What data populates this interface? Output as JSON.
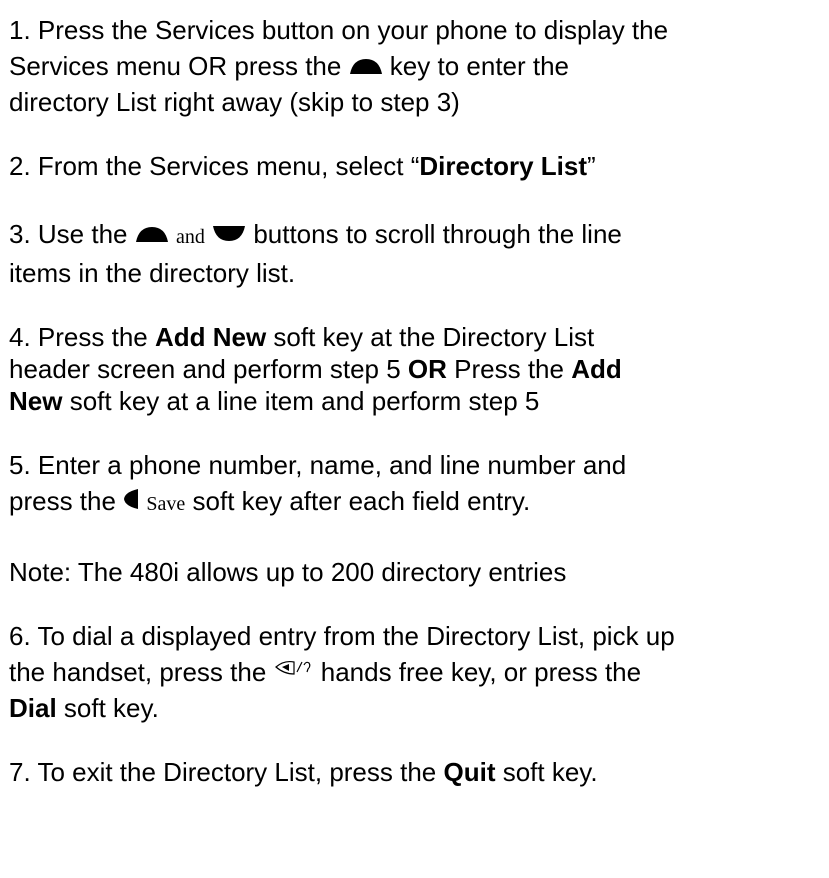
{
  "step1": {
    "l1": "1. Press the Services button on your phone to display the",
    "l2a": "Services menu OR press the ",
    "l2b": " key to enter the",
    "l3": "directory List right away (skip to step 3)"
  },
  "step2": {
    "a": "2. From the Services menu, select “",
    "bold": "Directory List",
    "b": "”"
  },
  "step3": {
    "a": "3. Use the ",
    "and": "and",
    "b": " buttons to scroll through the line",
    "l2": "items in the directory list."
  },
  "step4": {
    "l1a": "4. Press the ",
    "l1bold": "Add New",
    "l1b": " soft key at the Directory List",
    "l2a": "header screen and perform step 5 ",
    "l2bold1": "OR",
    "l2b": " Press the ",
    "l2bold2": "Add",
    "l3bold": "New",
    "l3b": " soft key at a line item and perform step 5"
  },
  "step5": {
    "l1": "5. Enter a phone number, name, and line number and",
    "l2a": "press the ",
    "save": "Save",
    "l2b": " soft key after each field entry."
  },
  "note": "Note: The 480i allows up to 200 directory entries",
  "step6": {
    "l1": "6. To dial a displayed entry from the Directory List, pick up",
    "l2a": "the handset, press the ",
    "l2b": " hands free key, or press the",
    "l3bold": "Dial",
    "l3b": " soft key."
  },
  "step7": {
    "a": "7. To exit the Directory List, press the ",
    "bold": "Quit",
    "b": " soft key."
  },
  "icons": {
    "up": "up-arrow-key-icon",
    "down": "down-arrow-key-icon",
    "left": "left-arrow-key-icon",
    "handsfree": "handsfree-key-icon"
  }
}
